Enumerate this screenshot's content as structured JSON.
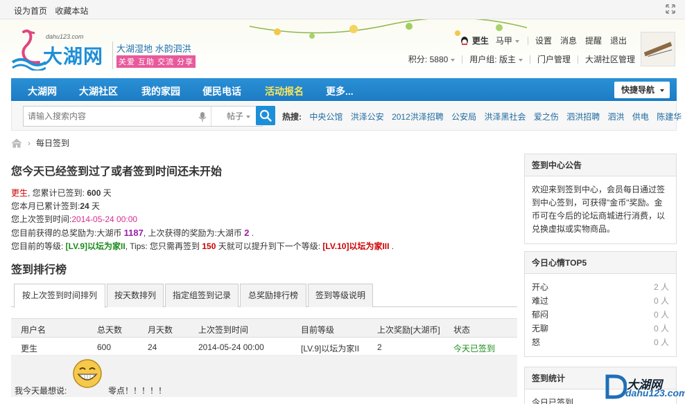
{
  "topbar": {
    "set_home": "设为首页",
    "bookmark": "收藏本站"
  },
  "logo": {
    "domain": "dahu123.com",
    "name": "大湖网",
    "slogan1": "大湖湿地 水韵泗洪",
    "slogan2": "关爱 互助 交流 分享"
  },
  "user": {
    "name": "更生",
    "horse": "马甲",
    "settings": "设置",
    "messages": "消息",
    "reminders": "提醒",
    "logout": "退出",
    "points": "积分: 5880",
    "group": "用户组: 版主",
    "portal_admin": "门户管理",
    "community_admin": "大湖社区管理"
  },
  "nav": {
    "items": [
      "大湖网",
      "大湖社区",
      "我的家园",
      "便民电话",
      "活动报名",
      "更多..."
    ],
    "quick_nav": "快捷导航"
  },
  "search": {
    "placeholder": "请输入搜索内容",
    "scope": "帖子",
    "hot_label": "热搜:",
    "hot": [
      "中央公馆",
      "洪泽公安",
      "2012洪泽招聘",
      "公安局",
      "洪泽黑社会",
      "爱之伤",
      "泗洪招聘",
      "泗洪",
      "供电",
      "陈建华"
    ]
  },
  "breadcrumb": {
    "current": "每日签到"
  },
  "main": {
    "headline": "您今天已经签到过了或者签到时间还未开始",
    "line1_name": "更生",
    "line1_text": ", 您累计已签到: ",
    "line1_num": "600",
    "line1_unit": " 天",
    "line2_text": "您本月已累计签到:",
    "line2_num": "24",
    "line2_unit": " 天",
    "line3_text": "您上次签到时间:",
    "line3_time": "2014-05-24 00:00",
    "line4_a": "您目前获得的总奖励为:大湖币 ",
    "line4_total": "1187",
    "line4_b": ", 上次获得的奖励为:大湖币 ",
    "line4_last": "2",
    "line4_c": " .",
    "line5_a": "您目前的等级: ",
    "line5_level": "[LV.9]以坛为家II",
    "line5_b": ", Tips: 您只需再签到 ",
    "line5_days": "150",
    "line5_c": " 天就可以提升到下一个等级: ",
    "line5_next": "[LV.10]以坛为家III",
    "line5_d": " .",
    "rank_title": "签到排行榜"
  },
  "tabs": [
    "按上次签到时间排列",
    "按天数排列",
    "指定组签到记录",
    "总奖励排行榜",
    "签到等级说明"
  ],
  "table": {
    "headers": [
      "用户名",
      "总天数",
      "月天数",
      "上次签到时间",
      "目前等级",
      "上次奖励[大湖币]",
      "状态"
    ],
    "rows": [
      [
        "更生",
        "600",
        "24",
        "2014-05-24 00:00",
        "[LV.9]以坛为家II",
        "2",
        "今天已签到"
      ]
    ],
    "mood_label": "我今天最想说:",
    "mood_text": "零点！！！！！"
  },
  "sidebar": {
    "notice_title": "签到中心公告",
    "notice_body": "欢迎来到签到中心，会员每日通过签到中心签到，可获得\"金币\"奖励。金币可在今后的论坛商城进行消费，以兑换虚拟或实物商品。",
    "mood_title": "今日心情TOP5",
    "moods": [
      {
        "label": "开心",
        "count": "2 人"
      },
      {
        "label": "难过",
        "count": "0 人"
      },
      {
        "label": "郁闷",
        "count": "0 人"
      },
      {
        "label": "无聊",
        "count": "0 人"
      },
      {
        "label": "怒",
        "count": "0 人"
      }
    ],
    "stats_title": "签到统计",
    "stats_first": "今日已签到"
  },
  "watermark": {
    "big": "大湖网",
    "small": "dahu123.com"
  },
  "colors": {
    "nav_blue": "#1d7bc4",
    "accent_pink": "#e85a9c",
    "active_nav": "#ffe85a"
  }
}
